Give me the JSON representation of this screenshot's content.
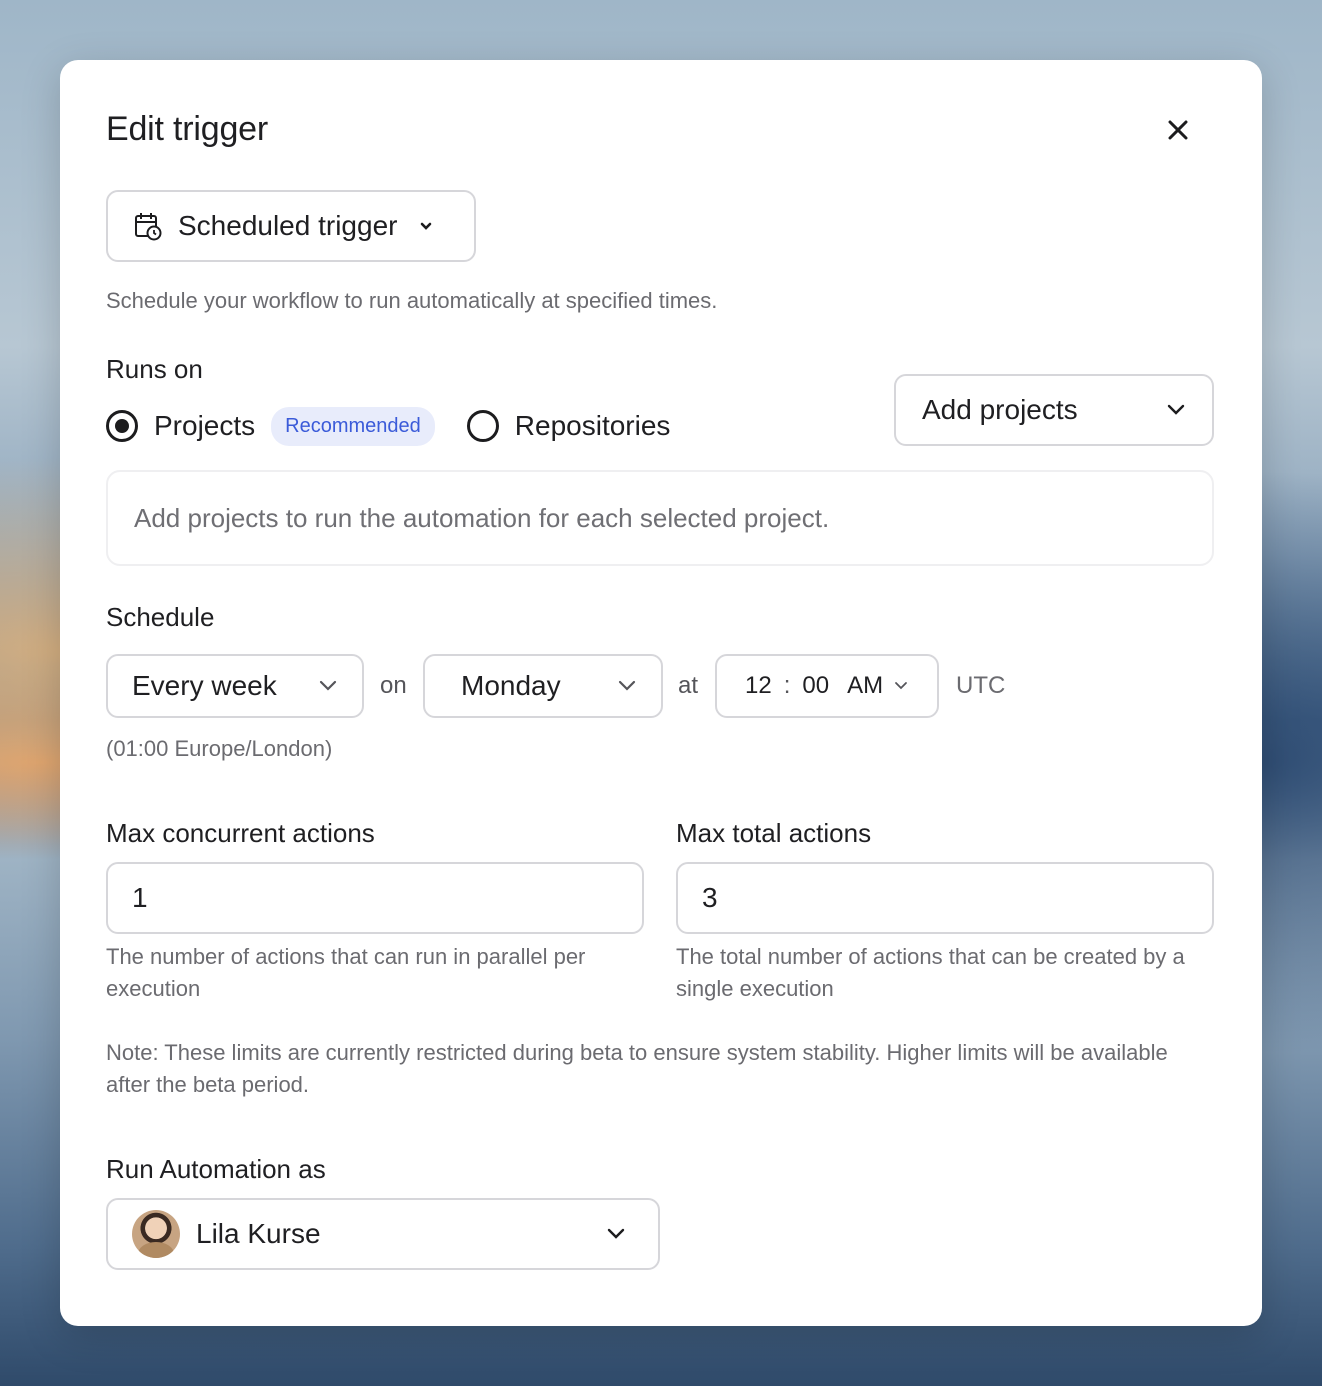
{
  "modal": {
    "title": "Edit trigger",
    "trigger_type": "Scheduled trigger",
    "description": "Schedule your workflow to run automatically at specified times."
  },
  "runs_on": {
    "label": "Runs on",
    "option_projects": "Projects",
    "recommended_badge": "Recommended",
    "option_repositories": "Repositories",
    "selected": "Projects",
    "add_projects_label": "Add projects",
    "info_text": "Add projects to run the automation for each selected project."
  },
  "schedule": {
    "label": "Schedule",
    "frequency": "Every week",
    "on_word": "on",
    "day": "Monday",
    "at_word": "at",
    "hour": "12",
    "separator": ":",
    "minute": "00",
    "ampm": "AM",
    "timezone": "UTC",
    "local_time": "(01:00 Europe/London)"
  },
  "limits": {
    "concurrent_label": "Max concurrent actions",
    "concurrent_value": "1",
    "concurrent_help": "The number of actions that can run in parallel per execution",
    "total_label": "Max total actions",
    "total_value": "3",
    "total_help": "The total number of actions that can be created by a single execution",
    "note": "Note: These limits are currently restricted during beta to ensure system stability. Higher limits will be available after the beta period."
  },
  "run_as": {
    "label": "Run Automation as",
    "user_name": "Lila Kurse"
  },
  "icons": {
    "close": "close-icon",
    "calendar_clock": "calendar-clock-icon",
    "chevron": "chevron-down-icon"
  }
}
